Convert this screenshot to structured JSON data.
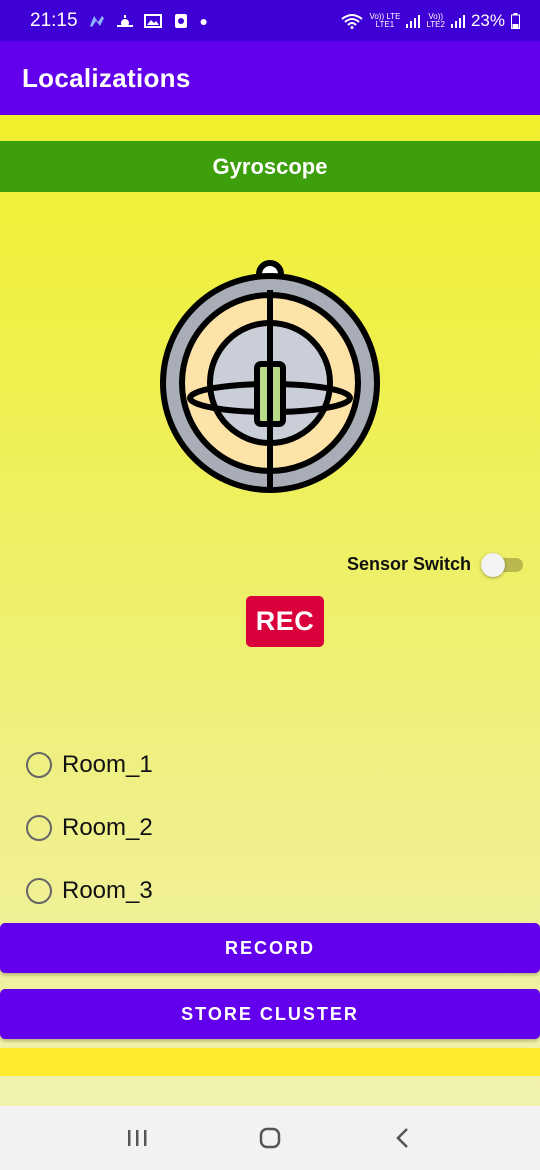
{
  "status_bar": {
    "time": "21:15",
    "battery": "23%",
    "sim1_label_top": "Vo)) LTE",
    "sim1_label_bottom": "LTE1",
    "sim2_label_top": "Vo))",
    "sim2_label_bottom": "LTE2",
    "icons": [
      "messenger-icon",
      "weather-icon",
      "gallery-icon",
      "app-icon",
      "dot-icon",
      "wifi-icon",
      "signal-icon",
      "battery-icon"
    ]
  },
  "appbar": {
    "title": "Localizations"
  },
  "banner": {
    "title": "Gyroscope"
  },
  "illustration": {
    "icon": "gyroscope-icon"
  },
  "sensor_switch": {
    "label": "Sensor Switch",
    "checked": false
  },
  "rec_badge": {
    "label": "REC"
  },
  "rooms": [
    {
      "label": "Room_1",
      "selected": false
    },
    {
      "label": "Room_2",
      "selected": false
    },
    {
      "label": "Room_3",
      "selected": false
    }
  ],
  "buttons": {
    "record": "RECORD",
    "store_cluster": "STORE CLUSTER"
  },
  "nav": {
    "icons": [
      "recents-icon",
      "home-icon",
      "back-icon"
    ]
  },
  "colors": {
    "status_bar": "#3f00d6",
    "primary": "#6200ee",
    "banner": "#3d9f0b",
    "rec": "#d9003c",
    "background_top": "#f0f01e",
    "bottom_strip": "#ffea2e"
  }
}
